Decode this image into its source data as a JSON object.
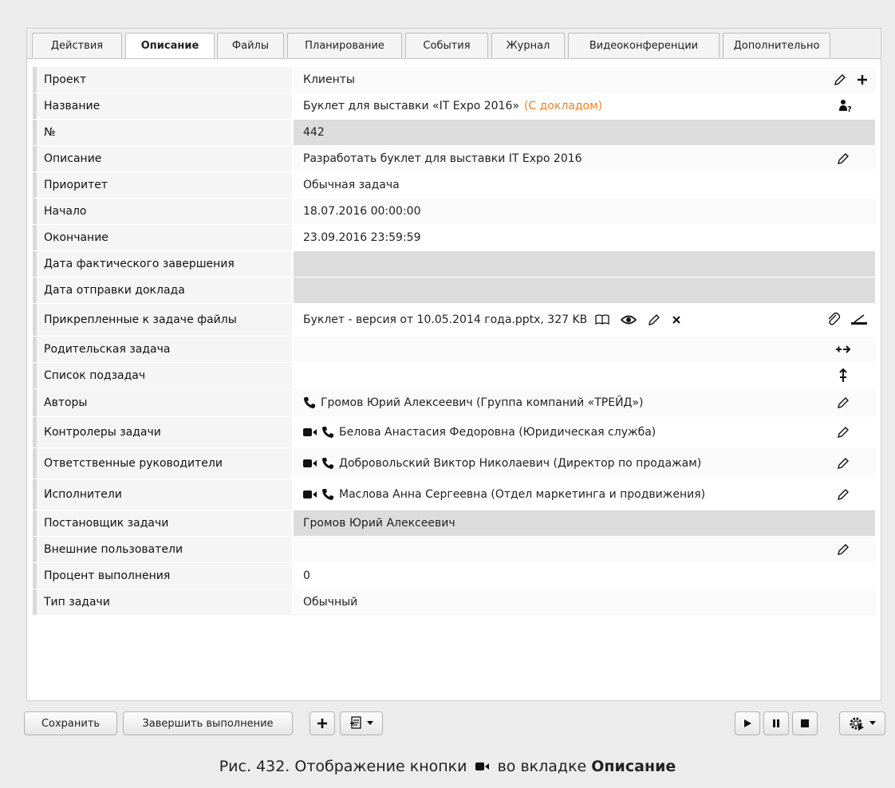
{
  "tabs": [
    {
      "label": "Действия"
    },
    {
      "label": "Описание",
      "active": true
    },
    {
      "label": "Файлы"
    },
    {
      "label": "Планирование"
    },
    {
      "label": "События"
    },
    {
      "label": "Журнал"
    },
    {
      "label": "Видеоконференции"
    },
    {
      "label": "Дополнительно"
    }
  ],
  "fields": {
    "project": {
      "label": "Проект",
      "value": "Клиенты"
    },
    "name": {
      "label": "Название",
      "value": "Буклет для выставки «IT Expo 2016»",
      "note": "(С докладом)"
    },
    "number": {
      "label": "№",
      "value": "442"
    },
    "description": {
      "label": "Описание",
      "value": "Разработать буклет для выставки IT Expo 2016"
    },
    "priority": {
      "label": "Приоритет",
      "value": "Обычная задача"
    },
    "start": {
      "label": "Начало",
      "value": "18.07.2016 00:00:00"
    },
    "end": {
      "label": "Окончание",
      "value": "23.09.2016 23:59:59"
    },
    "actual_end": {
      "label": "Дата фактического завершения",
      "value": ""
    },
    "report_date": {
      "label": "Дата отправки доклада",
      "value": ""
    },
    "files": {
      "label": "Прикрепленные к задаче файлы",
      "value": "Буклет - версия от 10.05.2014 года.pptx, 327 KB"
    },
    "parent": {
      "label": "Родительская задача",
      "value": ""
    },
    "subtasks": {
      "label": "Список подзадач",
      "value": ""
    },
    "authors": {
      "label": "Авторы",
      "value": "Громов Юрий Алексеевич (Группа компаний «ТРЕЙД»)"
    },
    "controllers": {
      "label": "Контролеры задачи",
      "value": "Белова Анастасия Федоровна (Юридическая служба)"
    },
    "managers": {
      "label": "Ответственные руководители",
      "value": "Добровольский Виктор Николаевич (Директор по продажам)"
    },
    "executors": {
      "label": "Исполнители",
      "value": "Маслова Анна Сергеевна (Отдел маркетинга и продвижения)"
    },
    "setter": {
      "label": "Постановщик задачи",
      "value": "Громов Юрий Алексеевич"
    },
    "external": {
      "label": "Внешние пользователи",
      "value": ""
    },
    "percent": {
      "label": "Процент выполнения",
      "value": "0"
    },
    "type": {
      "label": "Тип задачи",
      "value": "Обычный"
    }
  },
  "toolbar": {
    "save_label": "Сохранить",
    "finish_label": "Завершить выполнение"
  },
  "caption": {
    "prefix": "Рис. 432. Отображение кнопки",
    "middle": "во вкладке",
    "bold": "Описание"
  }
}
